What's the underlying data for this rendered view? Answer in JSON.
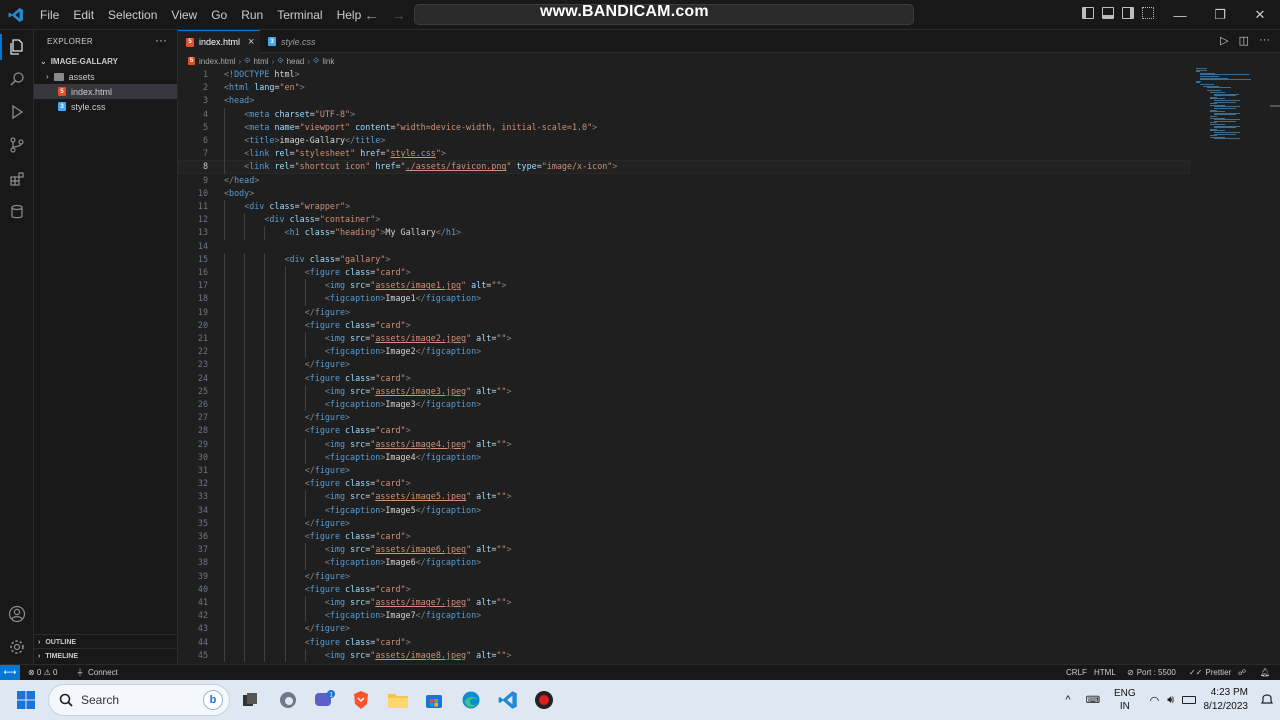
{
  "titlebar": {
    "menu": [
      "File",
      "Edit",
      "Selection",
      "View",
      "Go",
      "Run",
      "Terminal",
      "Help"
    ],
    "watermark": "www.BANDICAM.com"
  },
  "sidebar": {
    "title": "EXPLORER",
    "more": "···",
    "folder": "IMAGE-GALLARY",
    "items": [
      {
        "label": "assets",
        "type": "folder"
      },
      {
        "label": "index.html",
        "type": "html"
      },
      {
        "label": "style.css",
        "type": "css"
      }
    ],
    "outline": "OUTLINE",
    "timeline": "TIMELINE"
  },
  "tabs": [
    {
      "label": "index.html",
      "close": "×"
    },
    {
      "label": "style.css"
    }
  ],
  "breadcrumb": [
    "index.html",
    "html",
    "head",
    "link"
  ],
  "editor": {
    "current_line": 8,
    "lines": [
      "<!DOCTYPE html>",
      "<html lang=\"en\">",
      "<head>",
      "    <meta charset=\"UTF-8\">",
      "    <meta name=\"viewport\" content=\"width=device-width, initial-scale=1.0\">",
      "    <title>image-Gallary</title>",
      "    <link rel=\"stylesheet\" href=\"style.css\">",
      "    <link rel=\"shortcut icon\" href=\"./assets/favicon.png\" type=\"image/x-icon\">",
      "</head>",
      "<body>",
      "    <div class=\"wrapper\">",
      "        <div class=\"container\">",
      "            <h1 class=\"heading\">My Gallary</h1>",
      "",
      "            <div class=\"gallary\">",
      "                <figure class=\"card\">",
      "                    <img src=\"assets/image1.jpg\" alt=\"\">",
      "                    <figcaption>Image1</figcaption>",
      "                </figure>",
      "                <figure class=\"card\">",
      "                    <img src=\"assets/image2.jpeg\" alt=\"\">",
      "                    <figcaption>Image2</figcaption>",
      "                </figure>",
      "                <figure class=\"card\">",
      "                    <img src=\"assets/image3.jpeg\" alt=\"\">",
      "                    <figcaption>Image3</figcaption>",
      "                </figure>",
      "                <figure class=\"card\">",
      "                    <img src=\"assets/image4.jpeg\" alt=\"\">",
      "                    <figcaption>Image4</figcaption>",
      "                </figure>",
      "                <figure class=\"card\">",
      "                    <img src=\"assets/image5.jpeg\" alt=\"\">",
      "                    <figcaption>Image5</figcaption>",
      "                </figure>",
      "                <figure class=\"card\">",
      "                    <img src=\"assets/image6.jpeg\" alt=\"\">",
      "                    <figcaption>Image6</figcaption>",
      "                </figure>",
      "                <figure class=\"card\">",
      "                    <img src=\"assets/image7.jpeg\" alt=\"\">",
      "                    <figcaption>Image7</figcaption>",
      "                </figure>",
      "                <figure class=\"card\">",
      "                    <img src=\"assets/image8.jpeg\" alt=\"\">"
    ]
  },
  "statusbar": {
    "problems": "⊗ 0 ⚠ 0",
    "connect": "Connect",
    "eol": "CRLF",
    "language": "HTML",
    "port": "Port : 5500",
    "prettier": "Prettier"
  },
  "taskbar": {
    "search": "Search",
    "lang_top": "ENG",
    "lang_bottom": "IN",
    "time": "4:23 PM",
    "date": "8/12/2023"
  },
  "colors": {
    "accent": "#0078d4",
    "tag": "#569cd6",
    "attr": "#9cdcfe",
    "string": "#ce9178",
    "text": "#d4d4d4"
  }
}
